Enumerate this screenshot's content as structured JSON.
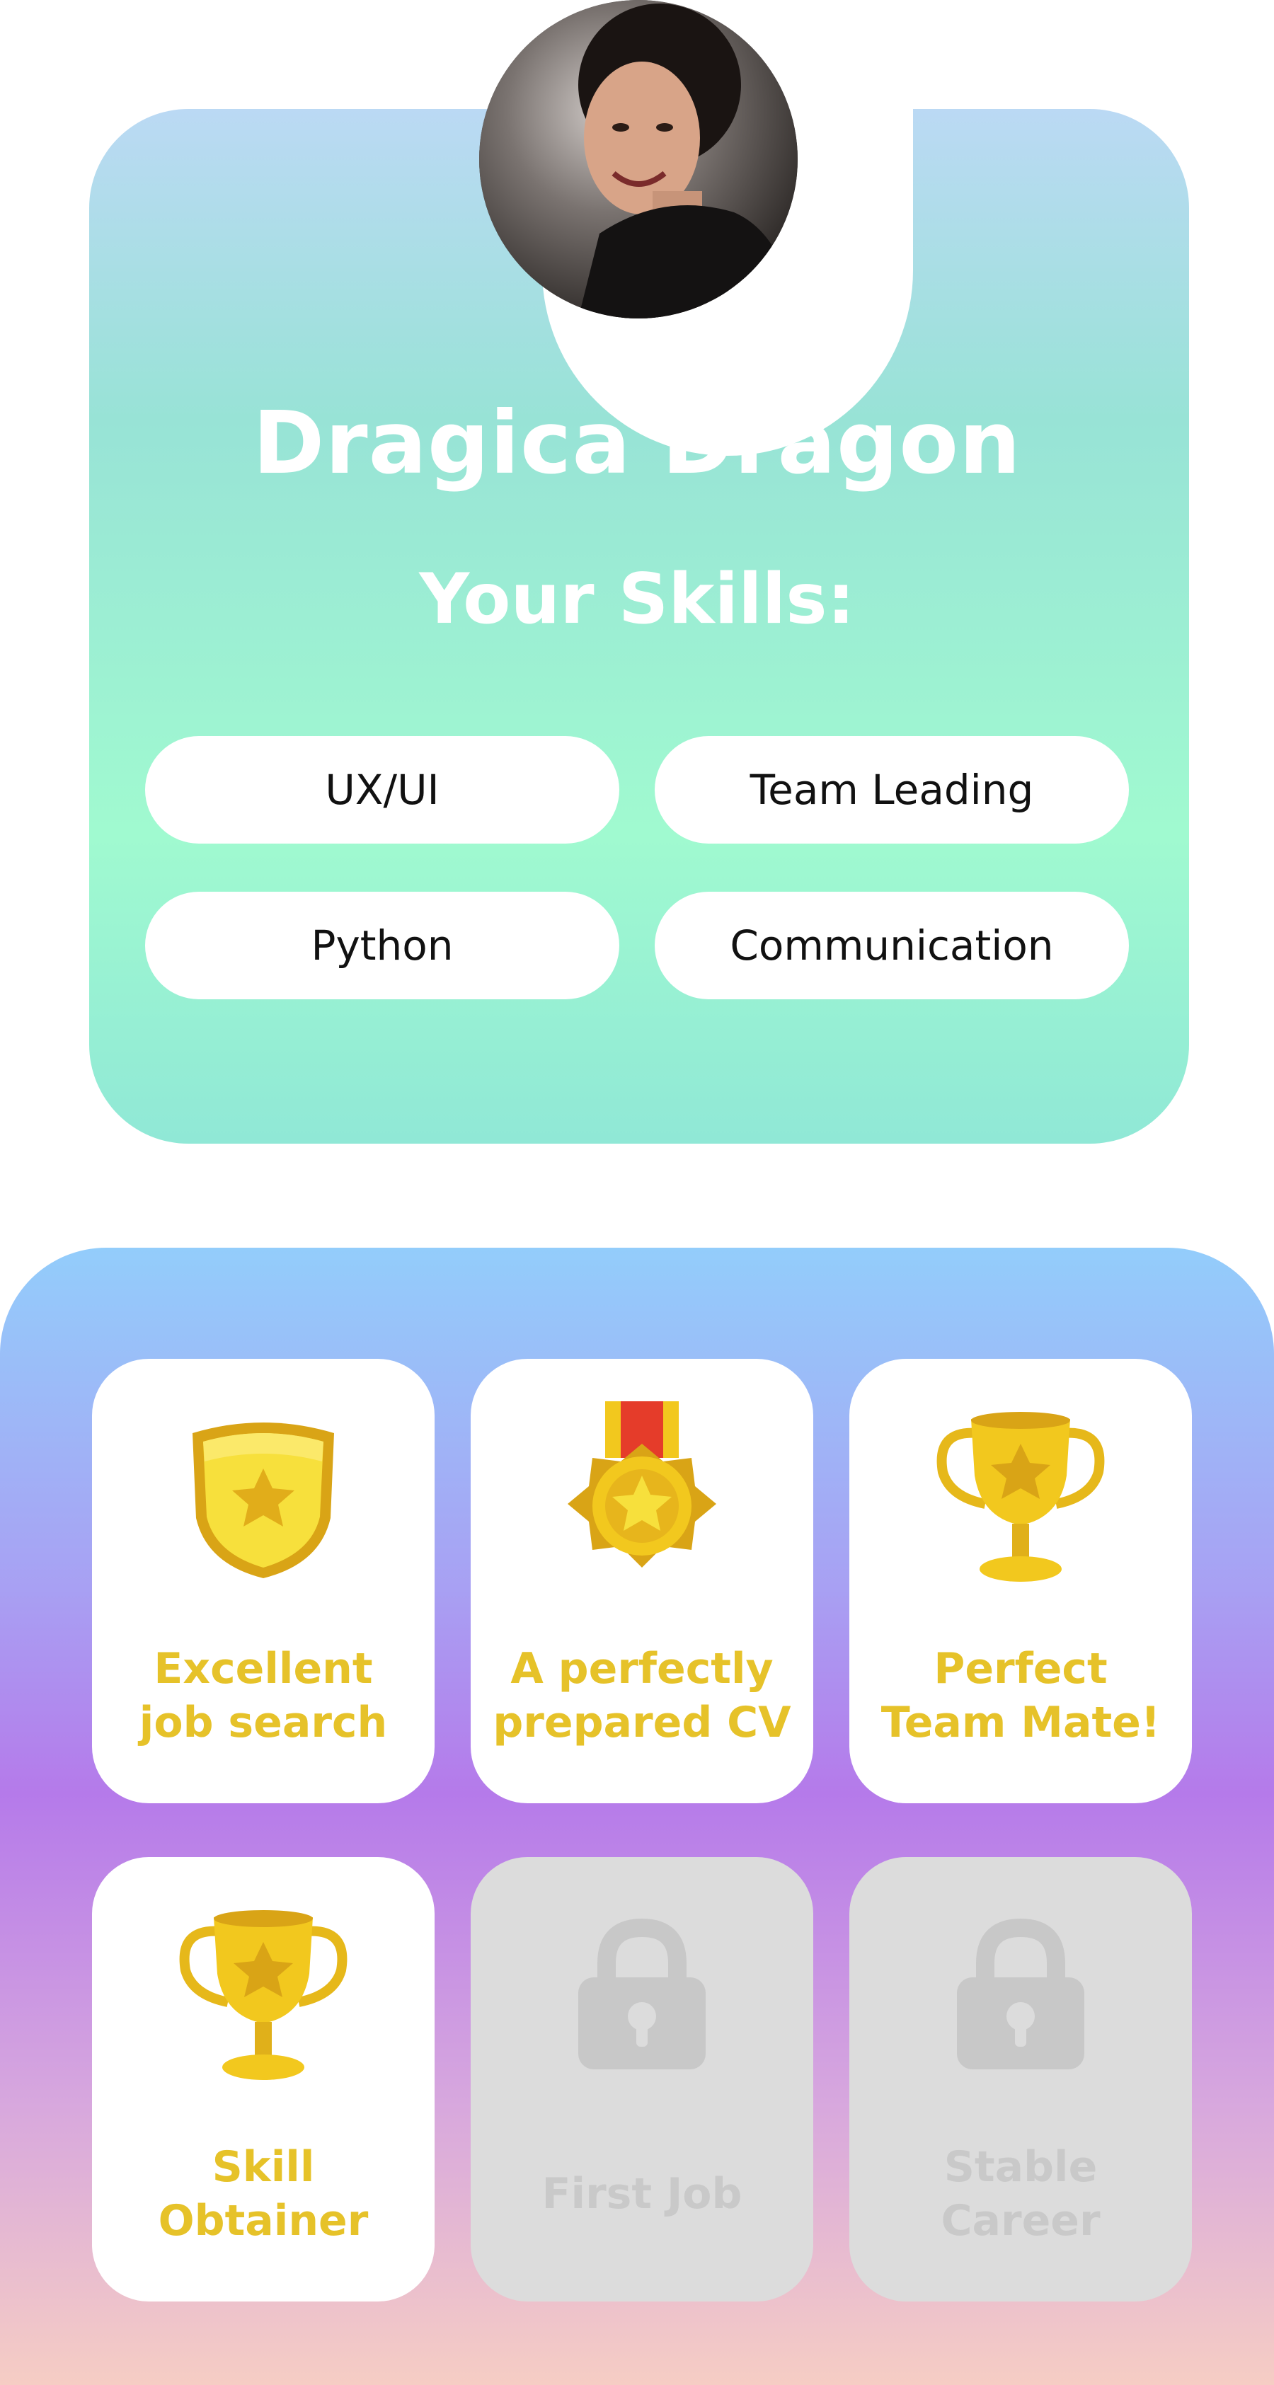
{
  "profile": {
    "name": "Dragica Dragon",
    "skills_heading": "Your Skills:",
    "skills": [
      "UX/UI",
      "Team Leading",
      "Python",
      "Communication"
    ]
  },
  "achievements": [
    {
      "line1": "Excellent",
      "line2": "job search",
      "icon": "shield-star-icon",
      "locked": false
    },
    {
      "line1": "A perfectly",
      "line2": "prepared CV",
      "icon": "medal-star-icon",
      "locked": false
    },
    {
      "line1": "Perfect",
      "line2": "Team Mate!",
      "icon": "trophy-icon",
      "locked": false
    },
    {
      "line1": "Skill",
      "line2": "Obtainer",
      "icon": "trophy-icon",
      "locked": false
    },
    {
      "line1": "First Job",
      "icon": "lock-icon",
      "locked": true
    },
    {
      "line1": "Stable",
      "line2": "Career",
      "icon": "lock-icon",
      "locked": true
    }
  ],
  "colors": {
    "badge_text": "#e6c229",
    "locked_text": "#c9c9c9",
    "gold": "#f2c81e",
    "gold_dark": "#d9a416"
  }
}
